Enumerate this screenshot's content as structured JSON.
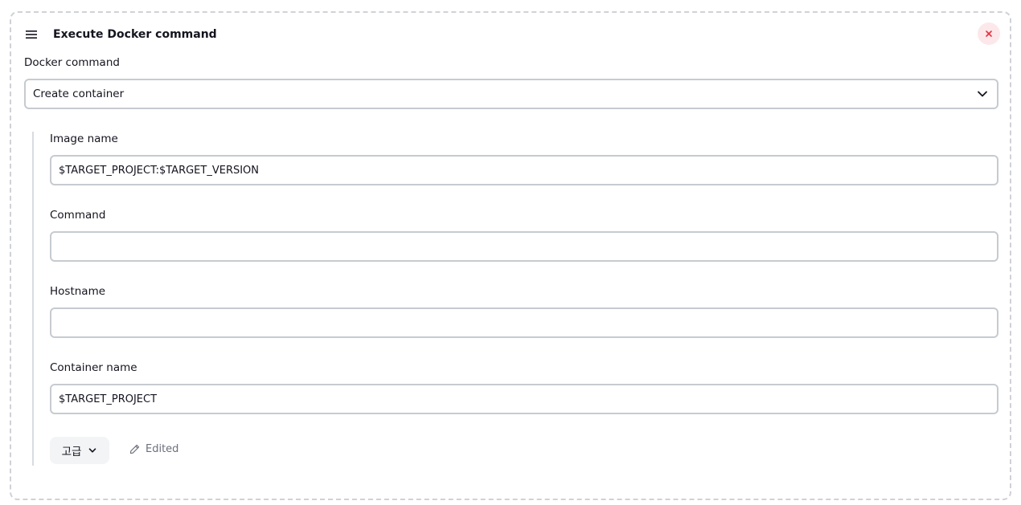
{
  "step": {
    "title": "Execute Docker command",
    "icons": {
      "drag_handle": "hamburger-icon",
      "close": "close-icon"
    },
    "accent_colors": {
      "close_bg": "#fce8ea",
      "close_x": "#e5323f"
    }
  },
  "docker_command": {
    "label": "Docker command",
    "selected": "Create container"
  },
  "fields": {
    "image_name": {
      "label": "Image name",
      "value": "$TARGET_PROJECT:$TARGET_VERSION"
    },
    "command": {
      "label": "Command",
      "value": ""
    },
    "hostname": {
      "label": "Hostname",
      "value": ""
    },
    "container_name": {
      "label": "Container name",
      "value": "$TARGET_PROJECT"
    }
  },
  "footer": {
    "advanced_label": "고급",
    "edited_label": "Edited"
  }
}
